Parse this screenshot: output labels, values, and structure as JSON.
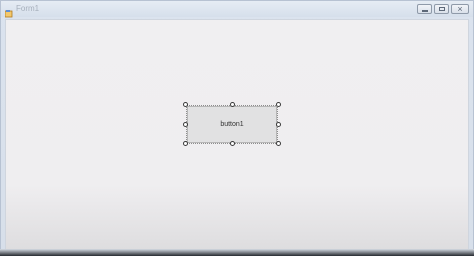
{
  "window": {
    "title": "Form1",
    "controls": {
      "minimize": "minimize",
      "maximize": "maximize",
      "close": "×"
    }
  },
  "designer": {
    "button1_label": "button1"
  }
}
